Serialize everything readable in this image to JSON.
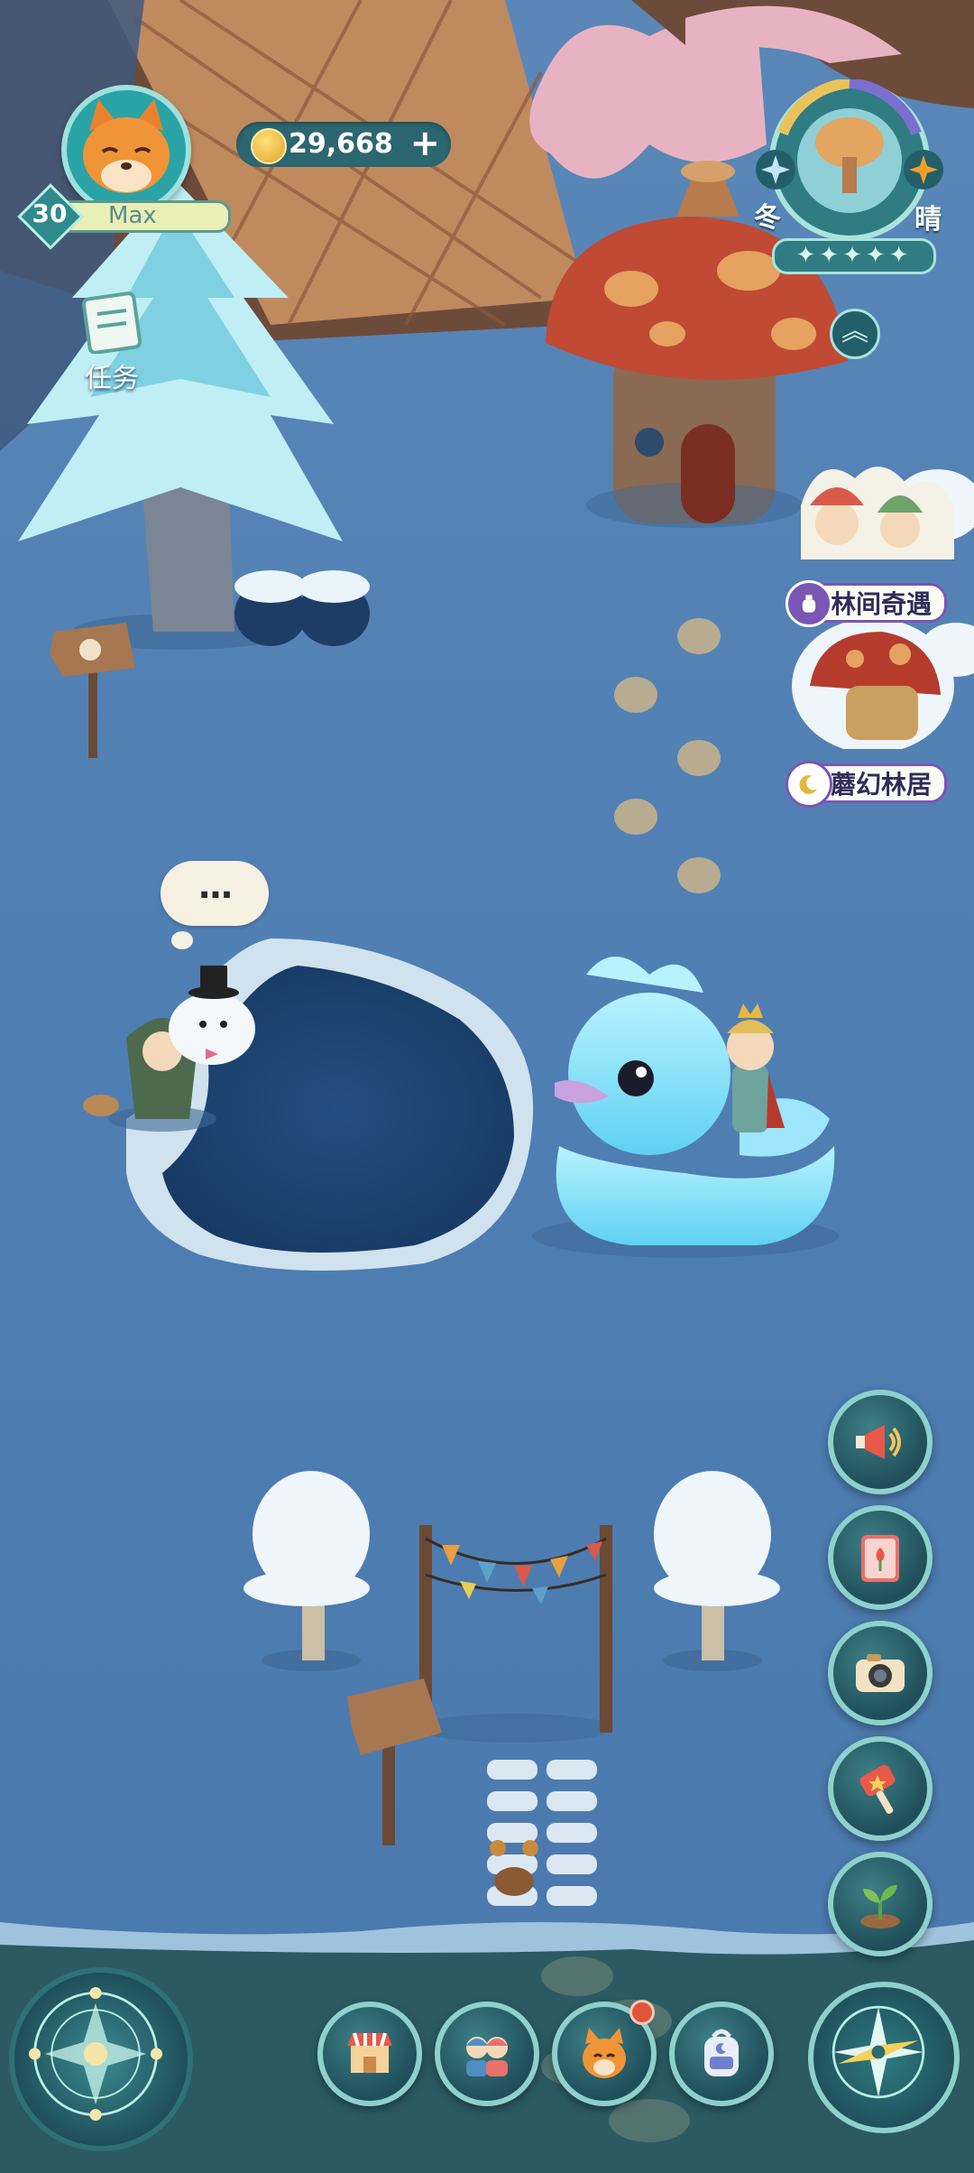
{
  "player": {
    "level": "30",
    "level_status": "Max",
    "avatar_icon": "fox-face-icon"
  },
  "currency": {
    "coins": "29,668",
    "coin_icon": "gold-coin-icon",
    "add_icon": "plus-icon"
  },
  "tasks": {
    "label": "任务",
    "icon": "task-scroll-icon"
  },
  "weather_dial": {
    "season": "冬",
    "weather": "晴",
    "star_rating": 5,
    "expand_icon": "double-chevron-up-icon"
  },
  "events": [
    {
      "label": "林间奇遇",
      "icon": "potion-bottle-icon"
    },
    {
      "label": "蘑幻林居",
      "icon": "crescent-moon-icon"
    }
  ],
  "npc_thought": {
    "text": "..."
  },
  "side_menu": [
    {
      "name": "announcement",
      "icon": "megaphone-icon"
    },
    {
      "name": "album",
      "icon": "tulip-book-icon"
    },
    {
      "name": "camera",
      "icon": "camera-icon"
    },
    {
      "name": "shop-hammer",
      "icon": "star-hammer-icon"
    },
    {
      "name": "plant",
      "icon": "sprout-icon"
    }
  ],
  "bottom_bar": [
    {
      "name": "store",
      "icon": "market-stall-icon"
    },
    {
      "name": "friends",
      "icon": "two-friends-icon"
    },
    {
      "name": "pet",
      "icon": "fox-pet-icon",
      "has_notification": true
    },
    {
      "name": "backpack",
      "icon": "backpack-icon"
    }
  ],
  "left_corner": {
    "icon": "magic-circle-icon"
  },
  "right_corner": {
    "icon": "compass-icon"
  },
  "colors": {
    "hud_teal": "#1f4f5a",
    "hud_ring": "#8fd0cc",
    "chip_purple": "#7a56b5",
    "snow_ground": "#4f7eb3",
    "notification_red": "#e0553a"
  }
}
